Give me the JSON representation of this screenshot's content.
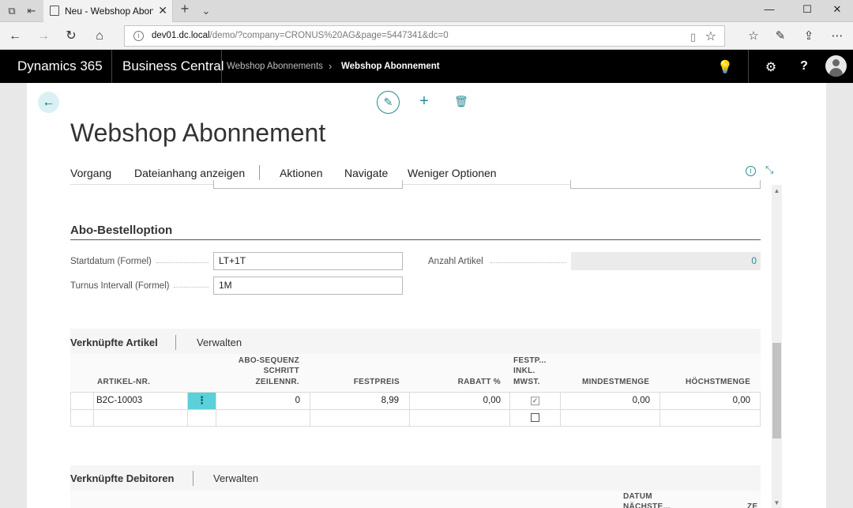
{
  "browser": {
    "tab_title": "Neu - Webshop Abonne",
    "url_host": "dev01.dc.local",
    "url_path": "/demo/?company=CRONUS%20AG&page=5447341&dc=0"
  },
  "app": {
    "product": "Dynamics 365",
    "module": "Business Central",
    "breadcrumb_parent": "Webshop Abonnements",
    "breadcrumb_current": "Webshop Abonnement"
  },
  "page": {
    "title": "Webshop Abonnement",
    "actions": [
      "Vorgang",
      "Dateianhang anzeigen",
      "Aktionen",
      "Navigate",
      "Weniger Optionen"
    ]
  },
  "section": {
    "title": "Abo-Bestelloption",
    "startdatum_label": "Startdatum (Formel)",
    "startdatum_value": "LT+1T",
    "turnus_label": "Turnus Intervall (Formel)",
    "turnus_value": "1M",
    "anzahl_label": "Anzahl Artikel",
    "anzahl_value": "0"
  },
  "artikel_part": {
    "title": "Verknüpfte Artikel",
    "action": "Verwalten",
    "headers": {
      "artikel_nr": "ARTIKEL-NR.",
      "abo_sequenz_1": "ABO-SEQUENZ",
      "abo_sequenz_2": "SCHRITT",
      "abo_sequenz_3": "ZEILENNR.",
      "festpreis": "FESTPREIS",
      "rabatt": "RABATT %",
      "festp_1": "FESTP...",
      "festp_2": "INKL.",
      "festp_3": "MWST.",
      "mindestmenge": "MINDESTMENGE",
      "hoechstmenge": "HÖCHSTMENGE"
    },
    "rows": [
      {
        "artikel_nr": "B2C-10003",
        "zeilennr": "0",
        "festpreis": "8,99",
        "rabatt": "0,00",
        "inkl_mwst": "☑",
        "mindestmenge": "0,00",
        "hoechstmenge": "0,00"
      }
    ],
    "row_menu": "⋮"
  },
  "debitoren_part": {
    "title": "Verknüpfte Debitoren",
    "action": "Verwalten",
    "header_datum": "DATUM",
    "header_naechste": "NÄCHSTE...",
    "header_ze": "ZE"
  },
  "icons": {
    "back": "arrow-left-icon",
    "edit": "pencil-icon",
    "add": "plus-icon",
    "delete": "trash-icon"
  },
  "colors": {
    "accent": "#2a8a96",
    "row_menu": "#5ad1da",
    "header_bg": "#000000"
  }
}
